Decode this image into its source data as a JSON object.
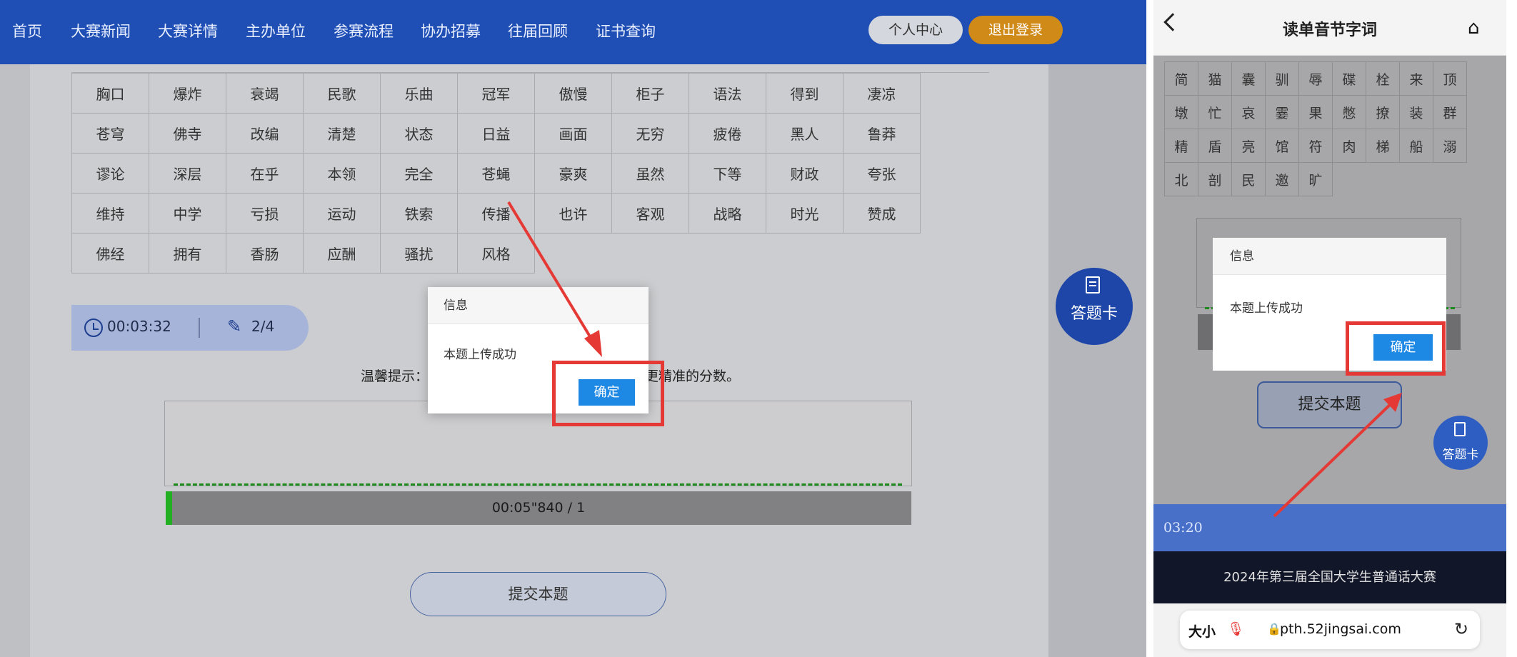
{
  "desktop": {
    "nav": [
      "首页",
      "大赛新闻",
      "大赛详情",
      "主办单位",
      "参赛流程",
      "协办招募",
      "往届回顾",
      "证书查询"
    ],
    "user_center": "个人中心",
    "logout": "退出登录",
    "words": [
      [
        "胸口",
        "爆炸",
        "衰竭",
        "民歌",
        "乐曲",
        "冠军",
        "傲慢",
        "柜子",
        "语法",
        "得到",
        "凄凉"
      ],
      [
        "苍穹",
        "佛寺",
        "改编",
        "清楚",
        "状态",
        "日益",
        "画面",
        "无穷",
        "疲倦",
        "黑人",
        "鲁莽"
      ],
      [
        "谬论",
        "深层",
        "在乎",
        "本领",
        "完全",
        "苍蝇",
        "豪爽",
        "虽然",
        "下等",
        "财政",
        "夸张"
      ],
      [
        "维持",
        "中学",
        "亏损",
        "运动",
        "铁索",
        "传播",
        "也许",
        "客观",
        "战略",
        "时光",
        "赞成"
      ],
      [
        "佛经",
        "拥有",
        "香肠",
        "应酬",
        "骚扰",
        "风格"
      ]
    ],
    "timer": "00:03:32",
    "progress": "2/4",
    "tip_left": "温馨提示：",
    "tip_right": "更精准的分数。",
    "player_time": "00:05\"840 / 1",
    "submit": "提交本题",
    "answer_card": "答题卡",
    "dialog": {
      "title": "信息",
      "body": "本题上传成功",
      "ok": "确定"
    }
  },
  "mobile": {
    "title": "读单音节字词",
    "chars": [
      [
        "简",
        "猫",
        "囊",
        "驯",
        "辱",
        "碟",
        "栓",
        "来",
        "顶"
      ],
      [
        "墩",
        "忙",
        "哀",
        "霎",
        "果",
        "憋",
        "撩",
        "装",
        "群"
      ],
      [
        "精",
        "盾",
        "亮",
        "馆",
        "符",
        "肉",
        "梯",
        "船",
        "溺"
      ],
      [
        "北",
        "剖",
        "民",
        "邀",
        "旷"
      ]
    ],
    "dialog": {
      "title": "信息",
      "body": "本题上传成功",
      "ok": "确定"
    },
    "submit": "提交本题",
    "answer_card": "答题卡",
    "timer": "03:20",
    "footer": "2024年第三届全国大学生普通话大赛",
    "url": {
      "size": "大小",
      "address": "pth.52jingsai.com"
    }
  },
  "colors": {
    "nav": "#1f4fb5",
    "accent": "#d08a18",
    "ok": "#1e88e5",
    "highlight": "#e53935"
  },
  "icons": [
    "back-icon",
    "home-icon",
    "clock-icon",
    "pencil-icon",
    "answer-card-icon",
    "mic-icon",
    "lock-icon",
    "reload-icon"
  ]
}
